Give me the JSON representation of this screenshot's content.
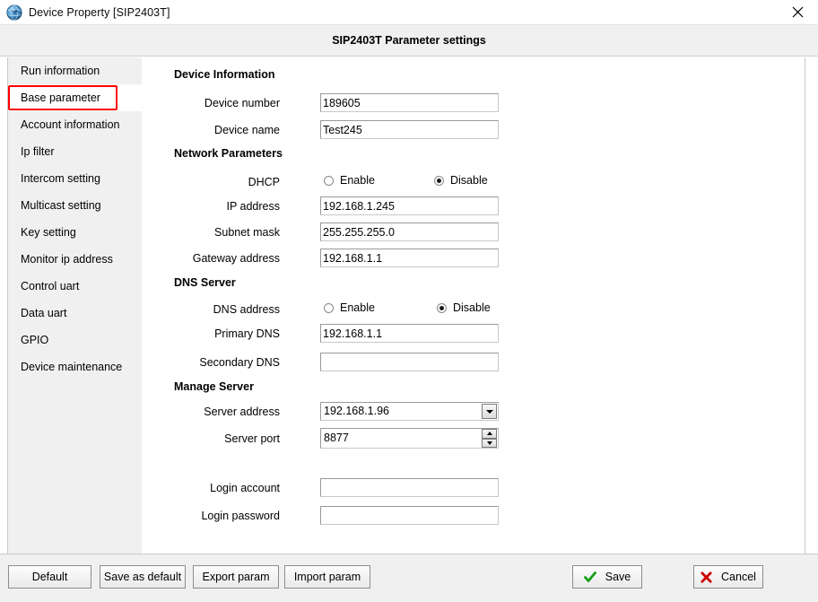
{
  "window": {
    "title": "Device Property [SIP2403T]",
    "icon": "globe-icon",
    "close_icon": "close-icon"
  },
  "header": {
    "title": "SIP2403T Parameter settings"
  },
  "sidebar": {
    "items": [
      {
        "label": "Run information",
        "selected": false
      },
      {
        "label": "Base parameter",
        "selected": true
      },
      {
        "label": "Account information",
        "selected": false
      },
      {
        "label": "Ip filter",
        "selected": false
      },
      {
        "label": "Intercom setting",
        "selected": false
      },
      {
        "label": "Multicast setting",
        "selected": false
      },
      {
        "label": "Key setting",
        "selected": false
      },
      {
        "label": "Monitor ip address",
        "selected": false
      },
      {
        "label": "Control uart",
        "selected": false
      },
      {
        "label": "Data uart",
        "selected": false
      },
      {
        "label": "GPIO",
        "selected": false
      },
      {
        "label": "Device maintenance",
        "selected": false
      }
    ],
    "selected_highlight_color": "#ff0000"
  },
  "form": {
    "groups": {
      "device_information": "Device Information",
      "network_parameters": "Network Parameters",
      "dns_server": "DNS Server",
      "manage_server": "Manage Server"
    },
    "device_number": {
      "label": "Device number",
      "value": "189605",
      "placeholder": ""
    },
    "device_name": {
      "label": "Device name",
      "value": "Test245",
      "placeholder": ""
    },
    "dhcp": {
      "label": "DHCP",
      "enable_label": "Enable",
      "disable_label": "Disable",
      "selected": "Disable"
    },
    "ip_address": {
      "label": "IP address",
      "value": "192.168.1.245",
      "placeholder": ""
    },
    "subnet_mask": {
      "label": "Subnet mask",
      "value": "255.255.255.0",
      "placeholder": ""
    },
    "gateway_address": {
      "label": "Gateway address",
      "value": "192.168.1.1",
      "placeholder": ""
    },
    "dns_address": {
      "label": "DNS address",
      "enable_label": "Enable",
      "disable_label": "Disable",
      "selected": "Disable"
    },
    "primary_dns": {
      "label": "Primary DNS",
      "value": "192.168.1.1",
      "placeholder": ""
    },
    "secondary_dns": {
      "label": "Secondary DNS",
      "value": "",
      "placeholder": ""
    },
    "server_address": {
      "label": "Server address",
      "value": "192.168.1.96"
    },
    "server_port": {
      "label": "Server port",
      "value": "8877"
    },
    "login_account": {
      "label": "Login account",
      "value": "",
      "placeholder": ""
    },
    "login_password": {
      "label": "Login password",
      "value": "",
      "placeholder": ""
    }
  },
  "footer": {
    "default_label": "Default",
    "save_as_default_label": "Save as default",
    "export_param_label": "Export param",
    "import_param_label": "Import param",
    "save_label": "Save",
    "cancel_label": "Cancel",
    "save_icon_color": "#14a014",
    "cancel_icon_color": "#cc0000"
  }
}
